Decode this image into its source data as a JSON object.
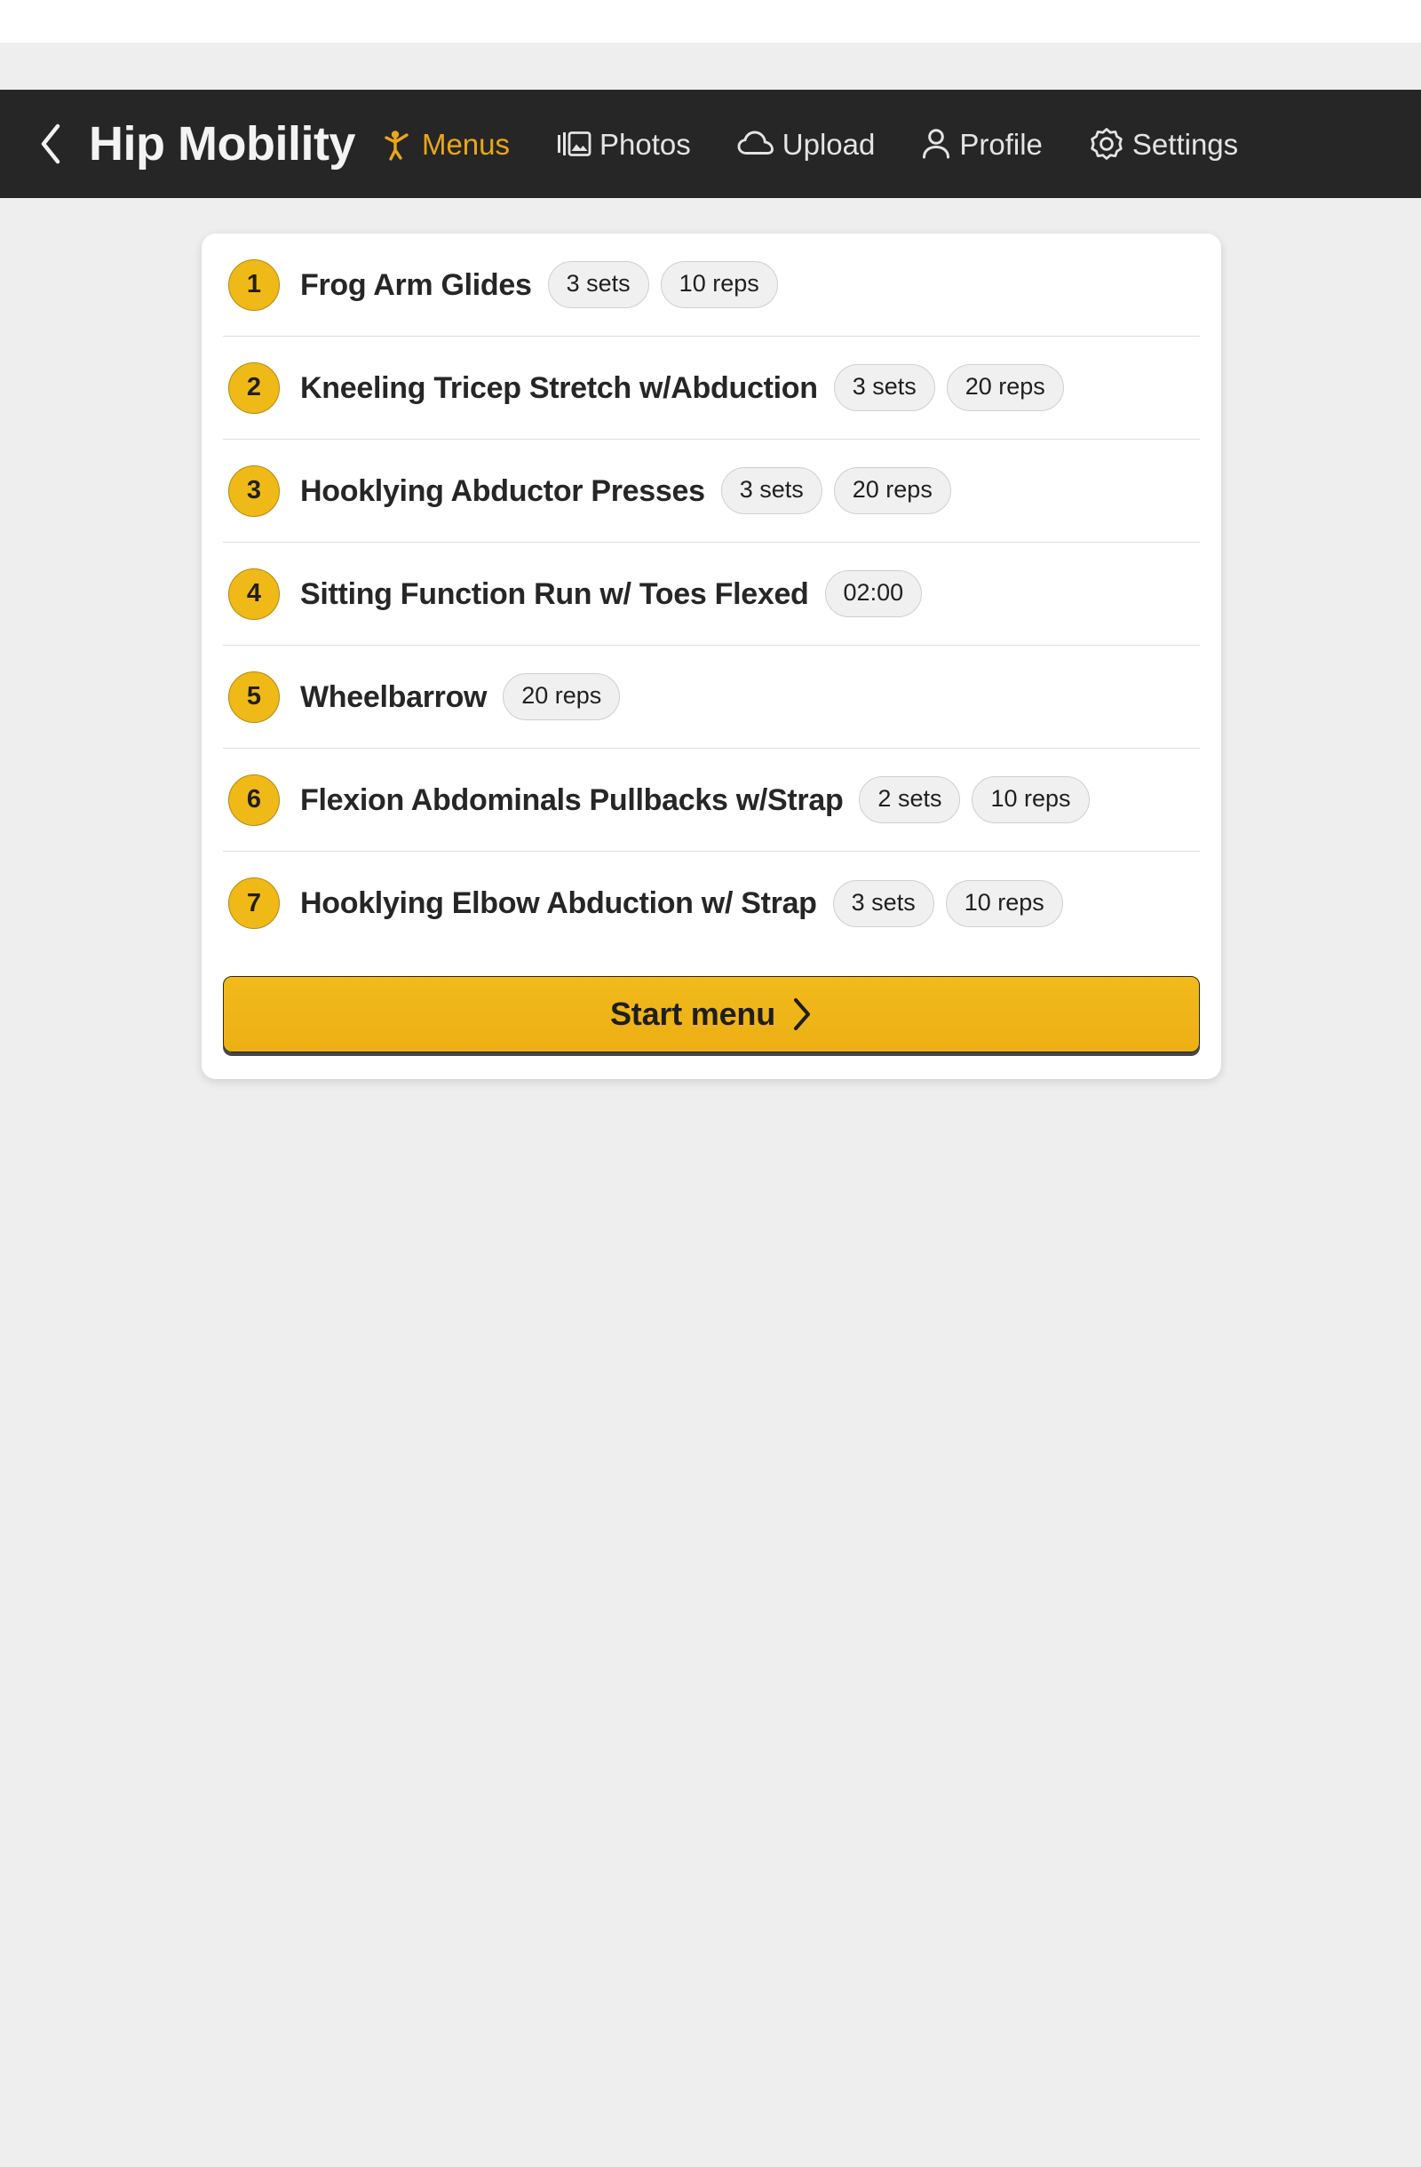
{
  "header": {
    "back_icon": "chevron-left-icon",
    "title": "Hip Mobility",
    "nav": [
      {
        "label": "Menus",
        "icon": "exercise-person-icon",
        "active": true
      },
      {
        "label": "Photos",
        "icon": "photos-icon",
        "active": false
      },
      {
        "label": "Upload",
        "icon": "cloud-upload-icon",
        "active": false
      },
      {
        "label": "Profile",
        "icon": "person-icon",
        "active": false
      },
      {
        "label": "Settings",
        "icon": "gear-icon",
        "active": false
      }
    ]
  },
  "exercises": [
    {
      "number": "1",
      "name": "Frog Arm Glides",
      "badges": [
        "3 sets",
        "10 reps"
      ]
    },
    {
      "number": "2",
      "name": "Kneeling Tricep Stretch w/Abduction",
      "badges": [
        "3 sets",
        "20 reps"
      ]
    },
    {
      "number": "3",
      "name": "Hooklying Abductor Presses",
      "badges": [
        "3 sets",
        "20 reps"
      ]
    },
    {
      "number": "4",
      "name": "Sitting Function Run w/ Toes Flexed",
      "badges": [
        "02:00"
      ]
    },
    {
      "number": "5",
      "name": "Wheelbarrow",
      "badges": [
        "20 reps"
      ]
    },
    {
      "number": "6",
      "name": "Flexion Abdominals Pullbacks w/Strap",
      "badges": [
        "2 sets",
        "10 reps"
      ]
    },
    {
      "number": "7",
      "name": "Hooklying Elbow Abduction w/ Strap",
      "badges": [
        "3 sets",
        "10 reps"
      ]
    }
  ],
  "start_button": {
    "label": "Start menu",
    "icon": "chevron-right-icon"
  },
  "colors": {
    "accent_gold": "#efb918",
    "header_bg": "#262626",
    "page_bg": "#eeeeee",
    "card_bg": "#ffffff",
    "badge_bg": "#f0f0f0"
  }
}
